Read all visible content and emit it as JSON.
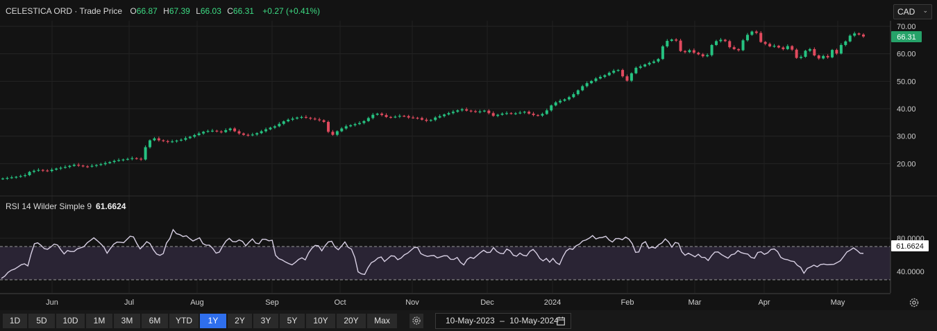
{
  "legend": {
    "instrument": "CELESTICA ORD",
    "sep": "·",
    "price_type": "Trade Price",
    "open_label": "O",
    "open": "66.87",
    "high_label": "H",
    "high": "67.39",
    "low_label": "L",
    "low": "66.03",
    "close_label": "C",
    "close": "66.31",
    "change": "+0.27 (+0.41%)"
  },
  "currency": {
    "selected": "CAD",
    "icon": "chevron-down-icon"
  },
  "rsi_legend": {
    "label": "RSI 14 Wilder Simple 9",
    "value": "61.6624"
  },
  "periods": [
    "1D",
    "5D",
    "10D",
    "1M",
    "3M",
    "6M",
    "YTD",
    "1Y",
    "2Y",
    "3Y",
    "5Y",
    "10Y",
    "20Y",
    "Max"
  ],
  "active_period": "1Y",
  "date_range": {
    "from": "10-May-2023",
    "sep": "–",
    "to": "10-May-2024"
  },
  "colors": {
    "up": "#26c281",
    "down": "#e04a5e",
    "rsi_line": "#d8d0e4",
    "rsi_band": "#2a2434",
    "accent": "#2f6fed",
    "last_price_tag": "#26a269"
  },
  "chart_data": [
    {
      "type": "candlestick",
      "ylim": [
        10,
        70
      ],
      "yticks": [
        "20.00",
        "30.00",
        "40.00",
        "50.00",
        "60.00",
        "70.00"
      ],
      "last_price": "66.31",
      "x_months": [
        "Jun",
        "Jul",
        "Aug",
        "Sep",
        "Oct",
        "Nov",
        "Dec",
        "2024",
        "Feb",
        "Mar",
        "Apr",
        "May"
      ],
      "close": [
        14.6,
        14.8,
        15,
        15.2,
        15.5,
        15.8,
        17,
        17.4,
        17.7,
        17.5,
        17.3,
        17.8,
        18.2,
        18.5,
        18.8,
        19.2,
        19.6,
        19.3,
        19,
        18.9,
        19.2,
        19.5,
        19.8,
        20.2,
        20.6,
        21,
        21.3,
        21.5,
        21.7,
        22,
        21.8,
        21.5,
        26,
        28.5,
        29.2,
        28.5,
        28.2,
        27.9,
        28.1,
        28.4,
        28.7,
        29.3,
        29.8,
        30.4,
        31,
        31.6,
        31.9,
        32,
        31.7,
        31.5,
        32.2,
        32.8,
        31.8,
        31,
        30.5,
        30.3,
        30.6,
        31.1,
        31.8,
        32.5,
        33.1,
        33.6,
        34.5,
        35.4,
        36,
        36.4,
        36.8,
        37,
        36.7,
        36.4,
        36.1,
        35.8,
        35.2,
        31.6,
        30.5,
        31.8,
        32.8,
        33.6,
        34,
        34.4,
        34.8,
        35.5,
        36.6,
        37.8,
        38.2,
        37.7,
        37,
        36.9,
        37.1,
        37.4,
        37.3,
        36.8,
        36.7,
        36.6,
        36,
        35.6,
        35.9,
        36.8,
        37.3,
        37.9,
        38.4,
        38.9,
        39.4,
        39.8,
        39.3,
        39.1,
        38.8,
        39,
        39.3,
        38.4,
        37.4,
        37.8,
        38.2,
        38.4,
        38.2,
        38.3,
        38.6,
        38.9,
        38.2,
        37.7,
        37.5,
        38.1,
        39.4,
        41.2,
        42.3,
        42.9,
        43.4,
        44.2,
        45.3,
        46.7,
        48.2,
        49.3,
        50.1,
        51,
        51.6,
        52.2,
        53.1,
        53.8,
        54.1,
        51.8,
        50.2,
        52.9,
        54.9,
        55.4,
        56.1,
        56.7,
        57.2,
        58.1,
        62.7,
        64.7,
        65.2,
        64.8,
        61,
        60.6,
        61.3,
        60.4,
        59.8,
        59.1,
        59.5,
        63.2,
        64.6,
        65.1,
        64.6,
        62.4,
        61.7,
        61.3,
        64.9,
        66.9,
        68.1,
        67.6,
        64.3,
        63.6,
        62.7,
        62.9,
        62.3,
        61.7,
        62.8,
        61.5,
        58.5,
        58.9,
        61.1,
        61.7,
        59.4,
        58.3,
        59.2,
        58.7,
        61.4,
        60.1,
        63.2,
        64.5,
        66.6,
        67.4,
        67,
        66.3
      ]
    },
    {
      "type": "line",
      "name": "RSI 14 Wilder Simple 9",
      "yticks": [
        "40.0000",
        "80.0000"
      ],
      "bands": [
        30,
        70
      ],
      "last_value": "61.6624",
      "values": [
        31.6,
        34.3,
        38.8,
        41.5,
        42.8,
        45.3,
        48.1,
        49.2,
        46.7,
        61.2,
        73.3,
        74.4,
        71.4,
        67.4,
        66.7,
        69.6,
        72.9,
        71.8,
        66.1,
        61.1,
        65.2,
        64,
        64,
        67.2,
        68.4,
        69.9,
        74.6,
        77.4,
        80.5,
        77.2,
        73.6,
        69.6,
        61.9,
        67.6,
        72.8,
        75.3,
        75.2,
        74.6,
        78.4,
        82.4,
        81.6,
        73.7,
        67.2,
        71.1,
        75.8,
        73.5,
        66.2,
        60.9,
        59.4,
        61.5,
        74.2,
        79.7,
        90.3,
        85.5,
        84.3,
        82,
        82.9,
        79.6,
        76.7,
        78.7,
        80.5,
        73.5,
        71.6,
        71.6,
        67.6,
        62,
        63.3,
        70.5,
        76.6,
        79.8,
        76,
        75.7,
        77.9,
        76.2,
        70.8,
        75.3,
        79.2,
        74.2,
        73.3,
        78.7,
        78.7,
        76.8,
        77.6,
        59.5,
        55.4,
        53.8,
        51.4,
        49.5,
        48,
        50.9,
        54.5,
        56.4,
        53.9,
        62.3,
        67.8,
        71.3,
        70.9,
        64.8,
        70.9,
        75.6,
        76.3,
        69.3,
        66.1,
        70.5,
        75.6,
        69.1,
        66.8,
        56.9,
        39.6,
        37.1,
        36.4,
        44.5,
        50.5,
        52.6,
        56.2,
        57.4,
        52,
        55.4,
        58.8,
        58.4,
        54.2,
        56.1,
        60,
        62,
        65.4,
        68.8,
        68.9,
        61.5,
        59.5,
        58.1,
        58.9,
        59.2,
        56.3,
        57.6,
        58.9,
        58.8,
        54.7,
        54.5,
        56.8,
        51,
        47.8,
        54.3,
        56.9,
        55.7,
        59.1,
        62.6,
        65.5,
        62.8,
        63.1,
        68.7,
        64.1,
        61.8,
        61.3,
        66.9,
        64.9,
        59.5,
        58.3,
        62.1,
        59.4,
        58.7,
        64.2,
        66.6,
        62.1,
        55.7,
        52.7,
        55.7,
        51.1,
        55.7,
        50.6,
        48.3,
        57.6,
        64.6,
        67.4,
        66.6,
        70.8,
        72.8,
        76.7,
        77.9,
        80.1,
        83.2,
        79.1,
        80.6,
        81,
        82.3,
        77.8,
        75.4,
        79.5,
        79.6,
        78.2,
        81.3,
        78.9,
        73.5,
        63,
        63.4,
        73.4,
        75.8,
        67.9,
        69.3,
        68.1,
        72.2,
        74.3,
        79.2,
        75.6,
        69.2,
        74.8,
        73.9,
        63.7,
        59.5,
        61.9,
        59.8,
        57.6,
        60.7,
        57,
        56.8,
        53.2,
        58.9,
        63.3,
        63.5,
        60.3,
        58.1,
        55.9,
        60.1,
        61,
        65.1,
        62.7,
        61.5,
        60.9,
        56.8,
        55.9,
        62.8,
        63.7,
        60.6,
        62.3,
        66.4,
        67.1,
        63.9,
        56.9,
        54.8,
        54.2,
        52.5,
        51.9,
        47.4,
        44.9,
        37.8,
        43.7,
        45.4,
        47.6,
        45.6,
        48.3,
        48.9,
        48.1,
        48.3,
        48.6,
        50.6,
        52.8,
        57.9,
        63.4,
        65.7,
        68.3,
        65.5,
        61.9,
        61.7
      ]
    }
  ]
}
